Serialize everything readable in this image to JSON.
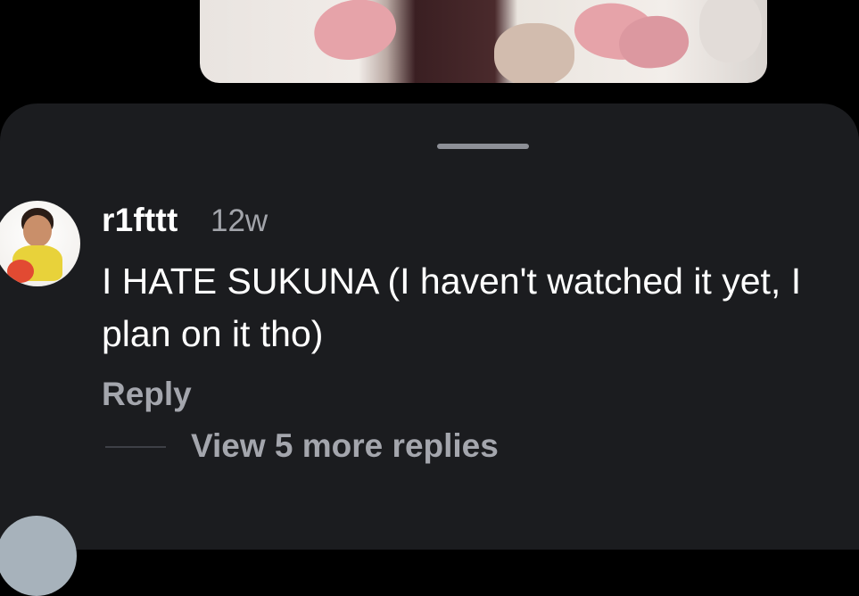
{
  "video": {
    "thumbnail_icon": "video-thumbnail-image"
  },
  "sheet": {
    "grabber_icon": "drag-handle-icon"
  },
  "comments": [
    {
      "avatar_icon": "user-avatar-photo",
      "username": "r1fttt",
      "timestamp": "12w",
      "text": "I HATE SUKUNA (I haven't watched it yet, I plan on it tho)",
      "reply_label": "Reply",
      "view_replies_label": "View 5 more replies"
    }
  ],
  "colors": {
    "sheet_background": "#1b1c1f",
    "primary_text": "#ffffff",
    "secondary_text": "#a2a4aa"
  }
}
